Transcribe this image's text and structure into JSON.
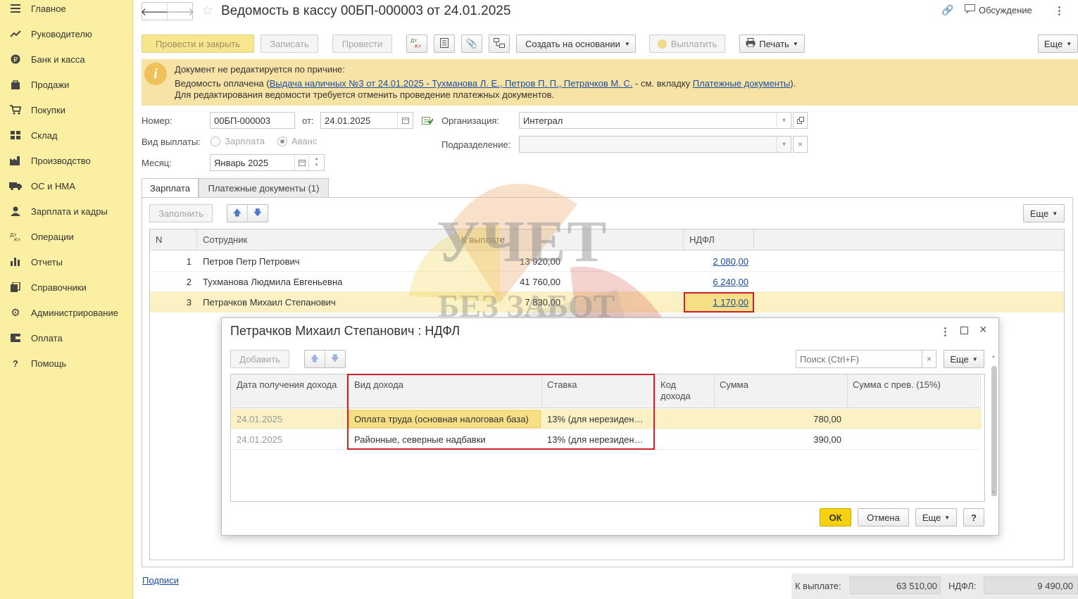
{
  "sidebar": {
    "items": [
      {
        "label": "Главное",
        "icon": "menu-icon"
      },
      {
        "label": "Руководителю",
        "icon": "trend-icon"
      },
      {
        "label": "Банк и касса",
        "icon": "ruble-icon"
      },
      {
        "label": "Продажи",
        "icon": "bag-icon"
      },
      {
        "label": "Покупки",
        "icon": "cart-icon"
      },
      {
        "label": "Склад",
        "icon": "grid-icon"
      },
      {
        "label": "Производство",
        "icon": "factory-icon"
      },
      {
        "label": "ОС и НМА",
        "icon": "truck-icon"
      },
      {
        "label": "Зарплата и кадры",
        "icon": "person-icon"
      },
      {
        "label": "Операции",
        "icon": "dtkt-icon"
      },
      {
        "label": "Отчеты",
        "icon": "barchart-icon"
      },
      {
        "label": "Справочники",
        "icon": "books-icon"
      },
      {
        "label": "Администрирование",
        "icon": "gear-icon"
      },
      {
        "label": "Оплата",
        "icon": "wallet-icon"
      },
      {
        "label": "Помощь",
        "icon": "question-icon"
      }
    ]
  },
  "header": {
    "title": "Ведомость в кассу 00БП-000003 от 24.01.2025",
    "discussion": "Обсуждение"
  },
  "toolbar": {
    "post_close": "Провести и закрыть",
    "save": "Записать",
    "post": "Провести",
    "dtkt": "Дт Кт",
    "create_based": "Создать на основании",
    "pay": "Выплатить",
    "print": "Печать",
    "more": "Еще"
  },
  "notice": {
    "line1": "Документ не редактируется по причине:",
    "line2_prefix": "Ведомость оплачена (",
    "line2_link": "Выдача наличных №3 от 24.01.2025 - Тухманова Л. Е., Петров П. П., Петрачков М. С.",
    "line2_mid": " - см. вкладку ",
    "line2_link2": "Платежные документы",
    "line2_suffix": ").",
    "line3": "Для редактирования ведомости требуется отменить проведение платежных документов."
  },
  "form": {
    "number_label": "Номер:",
    "number_value": "00БП-000003",
    "date_label": "от:",
    "date_value": "24.01.2025",
    "org_label": "Организация:",
    "org_value": "Интеграл",
    "paytype_label": "Вид выплаты:",
    "paytype_opt1": "Зарплата",
    "paytype_opt2": "Аванс",
    "dept_label": "Подразделение:",
    "month_label": "Месяц:",
    "month_value": "Январь 2025"
  },
  "tabs": {
    "tab1": "Зарплата",
    "tab2": "Платежные документы (1)"
  },
  "table": {
    "fill": "Заполнить",
    "more": "Еще",
    "headers": {
      "n": "N",
      "employee": "Сотрудник",
      "to_pay": "К выплате",
      "ndfl": "НДФЛ"
    },
    "rows": [
      {
        "n": "1",
        "employee": "Петров Петр Петрович",
        "to_pay": "13 920,00",
        "ndfl": "2 080,00"
      },
      {
        "n": "2",
        "employee": "Тухманова Людмила Евгеньевна",
        "to_pay": "41 760,00",
        "ndfl": "6 240,00"
      },
      {
        "n": "3",
        "employee": "Петрачков Михаил Степанович",
        "to_pay": "7 830,00",
        "ndfl": "1 170,00"
      }
    ]
  },
  "footer": {
    "signatures": "Подписи",
    "to_pay_label": "К выплате:",
    "to_pay_value": "63 510,00",
    "ndfl_label": "НДФЛ:",
    "ndfl_value": "9 490,00"
  },
  "watermark": {
    "line1": "УЧЕТ",
    "line2": "БЕЗ ЗАБОТ"
  },
  "dialog": {
    "title": "Петрачков Михаил Степанович : НДФЛ",
    "add": "Добавить",
    "search_placeholder": "Поиск (Ctrl+F)",
    "more": "Еще",
    "headers": {
      "date": "Дата получения дохода",
      "income_type": "Вид дохода",
      "rate": "Ставка",
      "code_l1": "Код",
      "code_l2": "дохода",
      "sum": "Сумма",
      "sum_prev": "Сумма с прев. (15%)"
    },
    "rows": [
      {
        "date": "24.01.2025",
        "income_type": "Оплата труда (основная налоговая база)",
        "rate": "13% (для нерезиден…",
        "sum": "780,00"
      },
      {
        "date": "24.01.2025",
        "income_type": "Районные, северные надбавки",
        "rate": "13% (для нерезиден…",
        "sum": "390,00"
      }
    ],
    "ok": "ОК",
    "cancel": "Отмена",
    "help": "?"
  },
  "colors": {
    "sidebar_bg": "#fbf0a2",
    "accent_yellow": "#f5d10f",
    "highlight_row": "#fbf1c4",
    "link_blue": "#1c4fa1",
    "annotation_red": "#d0202a"
  }
}
